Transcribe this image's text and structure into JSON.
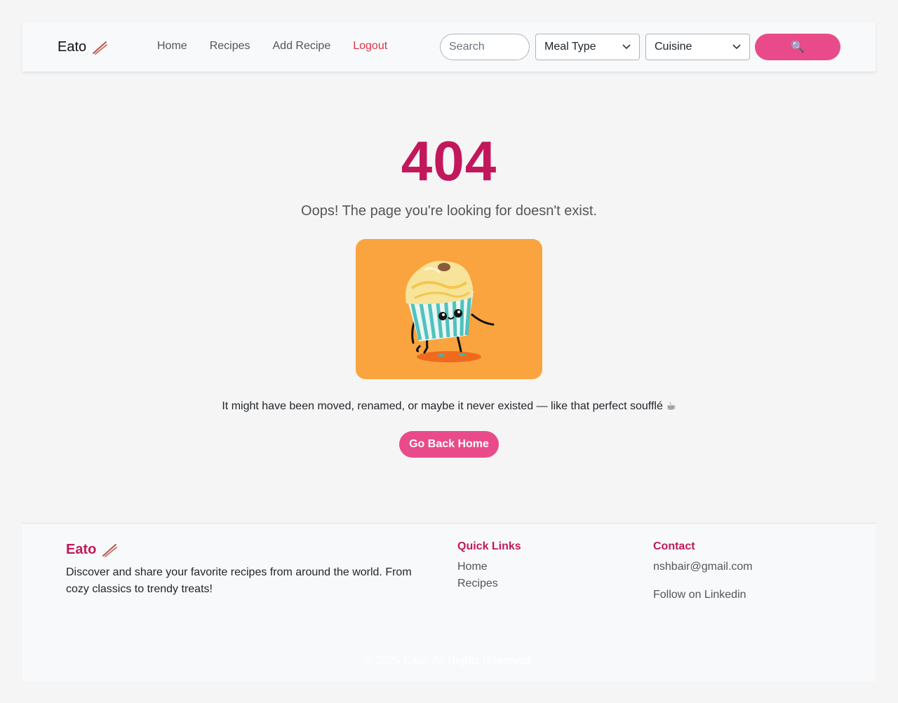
{
  "navbar": {
    "brand": "Eato",
    "links": [
      {
        "label": "Home"
      },
      {
        "label": "Recipes"
      },
      {
        "label": "Add Recipe"
      },
      {
        "label": "Logout"
      }
    ],
    "search_placeholder": "Search",
    "meal_type": "Meal Type",
    "cuisine": "Cuisine",
    "search_button_icon": "🔍"
  },
  "main": {
    "code": "404",
    "message": "Oops! The page you're looking for doesn't exist.",
    "subtext": "It might have been moved, renamed, or maybe it never existed — like that perfect soufflé ☕",
    "button": "Go Back Home"
  },
  "footer": {
    "brand": "Eato",
    "description": "Discover and share your favorite recipes from around the world. From cozy classics to trendy treats!",
    "quick_links_title": "Quick Links",
    "quick_links": [
      "Home",
      "Recipes"
    ],
    "contact_title": "Contact",
    "email": "nshbair@gmail.com",
    "linkedin": "Follow on Linkedin",
    "copyright": "© 2025 Eato. All Rights Reserved."
  },
  "colors": {
    "accent": "#e94b8a",
    "brand": "#c2185b",
    "logout": "#dc3545",
    "illustration_bg": "#f9a43f"
  }
}
